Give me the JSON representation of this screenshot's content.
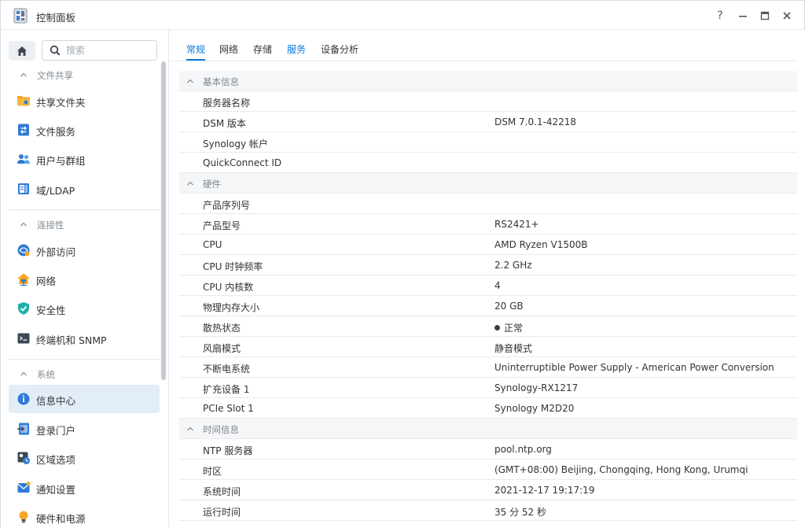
{
  "window": {
    "title": "控制面板"
  },
  "search": {
    "placeholder": "搜索"
  },
  "sidebar": {
    "sections": [
      {
        "label": "文件共享",
        "items": [
          {
            "label": "共享文件夹",
            "icon": "folder-icon"
          },
          {
            "label": "文件服务",
            "icon": "file-services-icon"
          },
          {
            "label": "用户与群组",
            "icon": "users-icon"
          },
          {
            "label": "域/LDAP",
            "icon": "domain-icon"
          }
        ]
      },
      {
        "label": "连接性",
        "items": [
          {
            "label": "外部访问",
            "icon": "external-access-icon"
          },
          {
            "label": "网络",
            "icon": "network-icon"
          },
          {
            "label": "安全性",
            "icon": "shield-icon"
          },
          {
            "label": "终端机和 SNMP",
            "icon": "terminal-icon"
          }
        ]
      },
      {
        "label": "系统",
        "items": [
          {
            "label": "信息中心",
            "icon": "info-icon",
            "active": true
          },
          {
            "label": "登录门户",
            "icon": "login-portal-icon"
          },
          {
            "label": "区域选项",
            "icon": "region-icon"
          },
          {
            "label": "通知设置",
            "icon": "notification-icon"
          },
          {
            "label": "硬件和电源",
            "icon": "bulb-icon"
          }
        ]
      }
    ]
  },
  "tabs": [
    {
      "label": "常规",
      "active": true
    },
    {
      "label": "网络"
    },
    {
      "label": "存储"
    },
    {
      "label": "服务"
    },
    {
      "label": "设备分析"
    }
  ],
  "info": {
    "basic": {
      "title": "基本信息",
      "rows": [
        {
          "k": "服务器名称",
          "v": ""
        },
        {
          "k": "DSM 版本",
          "v": "DSM 7.0.1-42218"
        },
        {
          "k": "Synology 帐户",
          "v": ""
        },
        {
          "k": "QuickConnect ID",
          "v": ""
        }
      ]
    },
    "hardware": {
      "title": "硬件",
      "rows": [
        {
          "k": "产品序列号",
          "v": ""
        },
        {
          "k": "产品型号",
          "v": "RS2421+"
        },
        {
          "k": "CPU",
          "v": "AMD Ryzen V1500B"
        },
        {
          "k": "CPU 时钟频率",
          "v": "2.2 GHz"
        },
        {
          "k": "CPU 内核数",
          "v": "4"
        },
        {
          "k": "物理内存大小",
          "v": "20 GB"
        },
        {
          "k": "散热状态",
          "v": "正常"
        },
        {
          "k": "风扇模式",
          "v": "静音模式"
        },
        {
          "k": "不断电系统",
          "v": "Uninterruptible Power Supply - American Power Conversion"
        },
        {
          "k": "扩充设备 1",
          "v": "Synology-RX1217"
        },
        {
          "k": "PCIe Slot 1",
          "v": "Synology M2D20"
        }
      ]
    },
    "time": {
      "title": "时间信息",
      "rows": [
        {
          "k": "NTP 服务器",
          "v": "pool.ntp.org"
        },
        {
          "k": "时区",
          "v": "(GMT+08:00) Beijing, Chongqing, Hong Kong, Urumqi"
        },
        {
          "k": "系统时间",
          "v": "2021-12-17 19:17:19"
        },
        {
          "k": "运行时间",
          "v": "35 分 52 秒"
        }
      ]
    }
  },
  "colors": {
    "accent": "#0b76d8",
    "active_bg": "#e3edf8",
    "group_bg": "#f5f6f8"
  }
}
